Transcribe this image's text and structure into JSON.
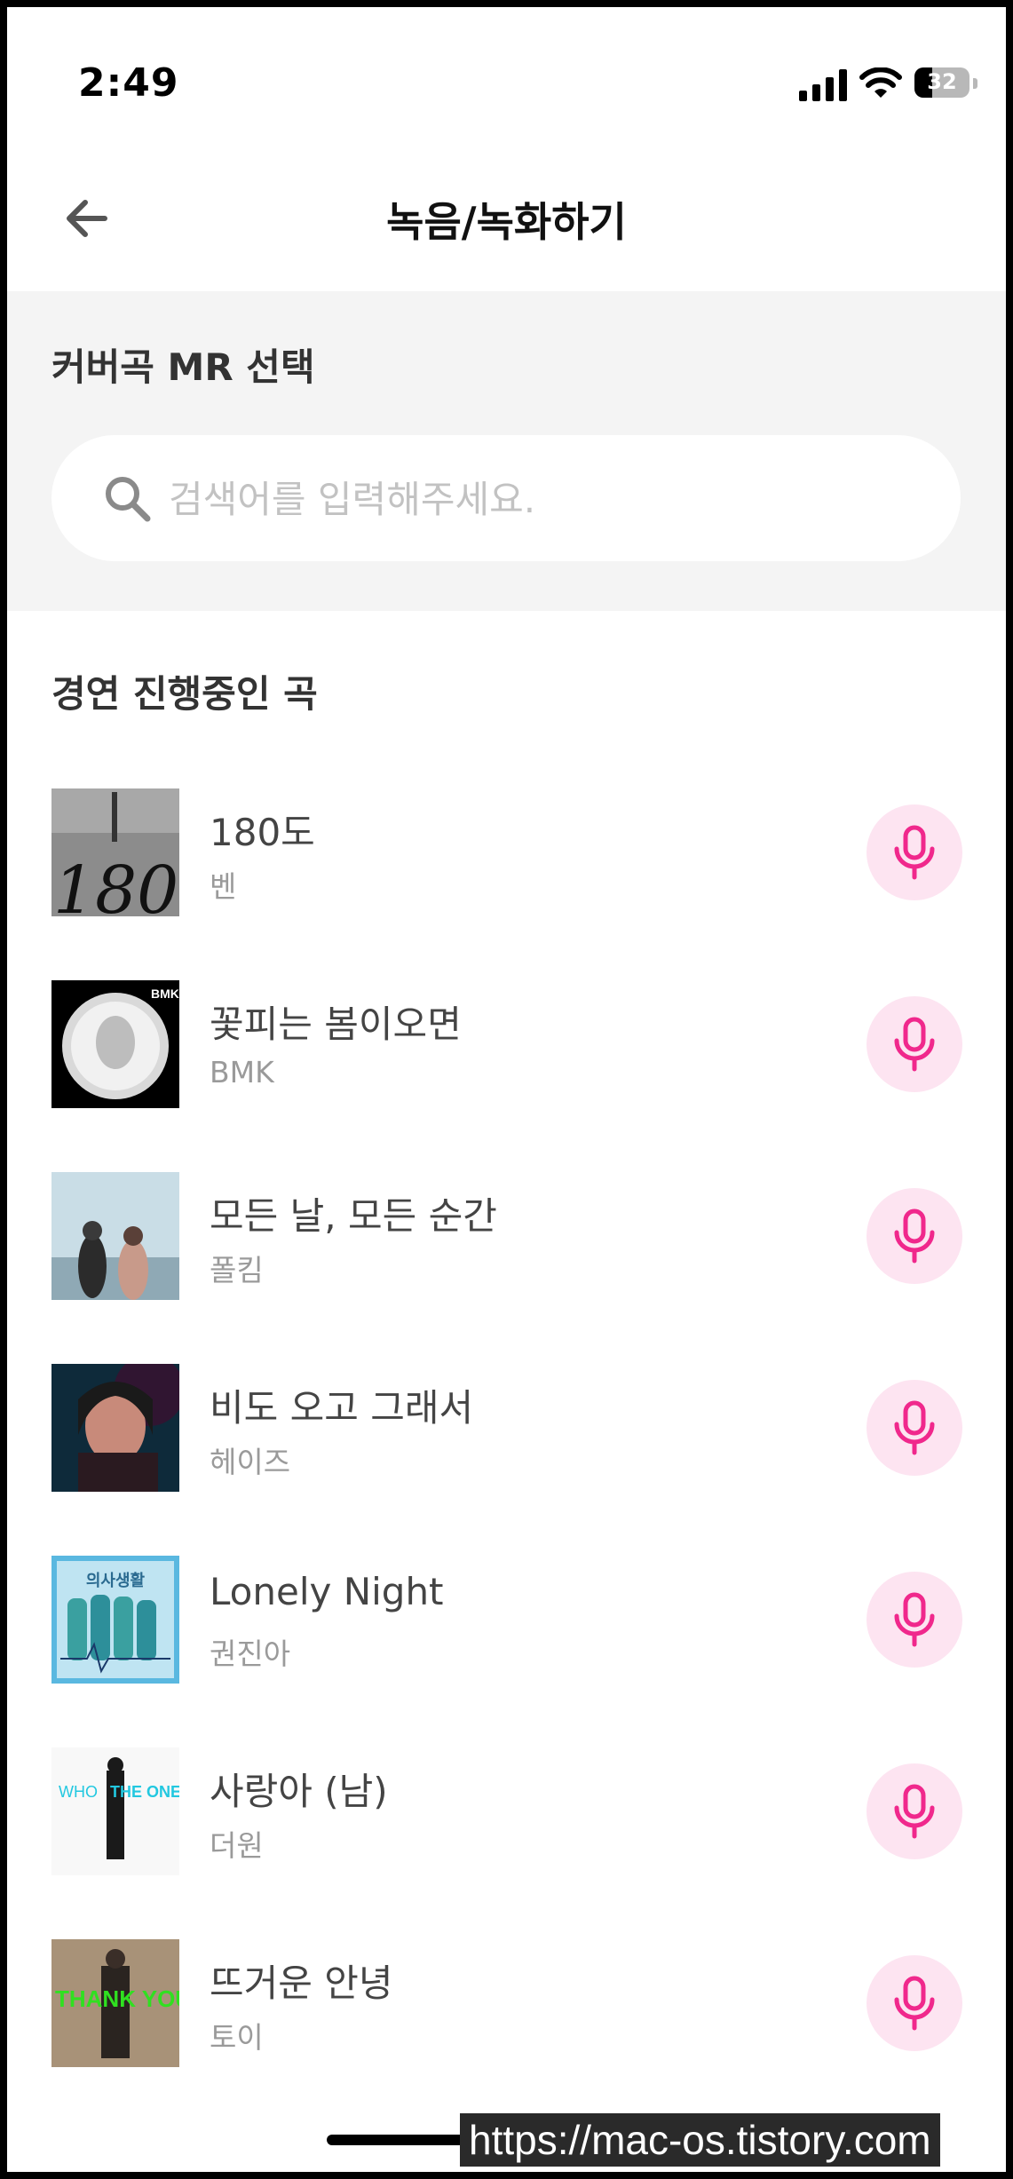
{
  "status_bar": {
    "time": "2:49",
    "battery_level": "32",
    "battery_fraction": 0.32
  },
  "header": {
    "title": "녹음/녹화하기",
    "back_icon": "arrow-left-icon"
  },
  "select_section": {
    "title": "커버곡 MR 선택",
    "search_placeholder": "검색어를 입력해주세요.",
    "search_value": ""
  },
  "list_section": {
    "title": "경연 진행중인 곡",
    "mic_icon": "microphone-icon",
    "songs": [
      {
        "title": "180도",
        "artist": "벤"
      },
      {
        "title": "꽃피는 봄이오면",
        "artist": "BMK"
      },
      {
        "title": "모든 날, 모든 순간",
        "artist": "폴킴"
      },
      {
        "title": "비도 오고 그래서",
        "artist": "헤이즈"
      },
      {
        "title": "Lonely Night",
        "artist": "권진아"
      },
      {
        "title": "사랑아 (남)",
        "artist": "더원"
      },
      {
        "title": "뜨거운 안녕",
        "artist": "토이"
      }
    ]
  },
  "cover_art": {
    "c1": "180°",
    "c2": "BMK",
    "c5": "의사생활",
    "c6a": "WHO",
    "c6b": "THE ONE",
    "c7": "THANK YOU"
  },
  "watermark": "https://mac-os.tistory.com",
  "colors": {
    "accent_pink": "#f0288c",
    "mic_bg": "#fde4f1",
    "section_bg": "#f4f4f4"
  }
}
